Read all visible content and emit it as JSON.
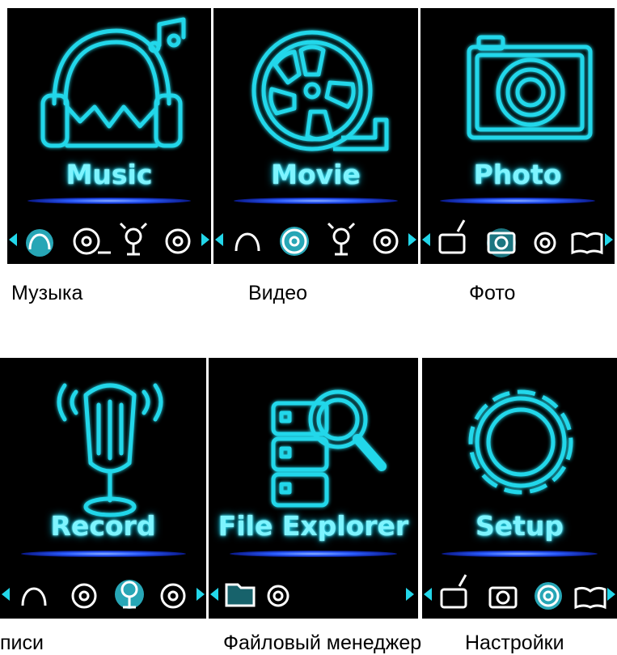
{
  "screens": [
    {
      "title": "Music",
      "caption": "Музыка",
      "icon": "headphones-icon",
      "nav": [
        "headphones-icon",
        "film-reel-icon",
        "microphone-icon",
        "disc-icon"
      ],
      "active_nav": 0
    },
    {
      "title": "Movie",
      "caption": "Видео",
      "icon": "film-reel-icon",
      "nav": [
        "headphones-icon",
        "film-reel-icon",
        "microphone-icon",
        "disc-icon"
      ],
      "active_nav": 1
    },
    {
      "title": "Photo",
      "caption": "Фото",
      "icon": "camera-icon",
      "nav": [
        "radio-icon",
        "camera-icon",
        "gear-icon",
        "book-icon"
      ],
      "active_nav": 1
    },
    {
      "title": "Record",
      "caption": "писи",
      "icon": "microphone-icon",
      "nav": [
        "headphones-icon",
        "film-reel-icon",
        "microphone-icon",
        "disc-icon"
      ],
      "active_nav": 2
    },
    {
      "title": "File Explorer",
      "caption": "Файловый менеджер",
      "icon": "file-search-icon",
      "nav": [
        "folder-icon",
        "gear-icon"
      ],
      "active_nav": 0
    },
    {
      "title": "Setup",
      "caption": "Настройки",
      "icon": "gear-icon",
      "nav": [
        "radio-icon",
        "camera-icon",
        "gear-icon",
        "book-icon"
      ],
      "active_nav": 2
    }
  ],
  "colors": {
    "screen_bg": "#000000",
    "accent": "#21d4e6",
    "glow": "#2a5cff"
  }
}
